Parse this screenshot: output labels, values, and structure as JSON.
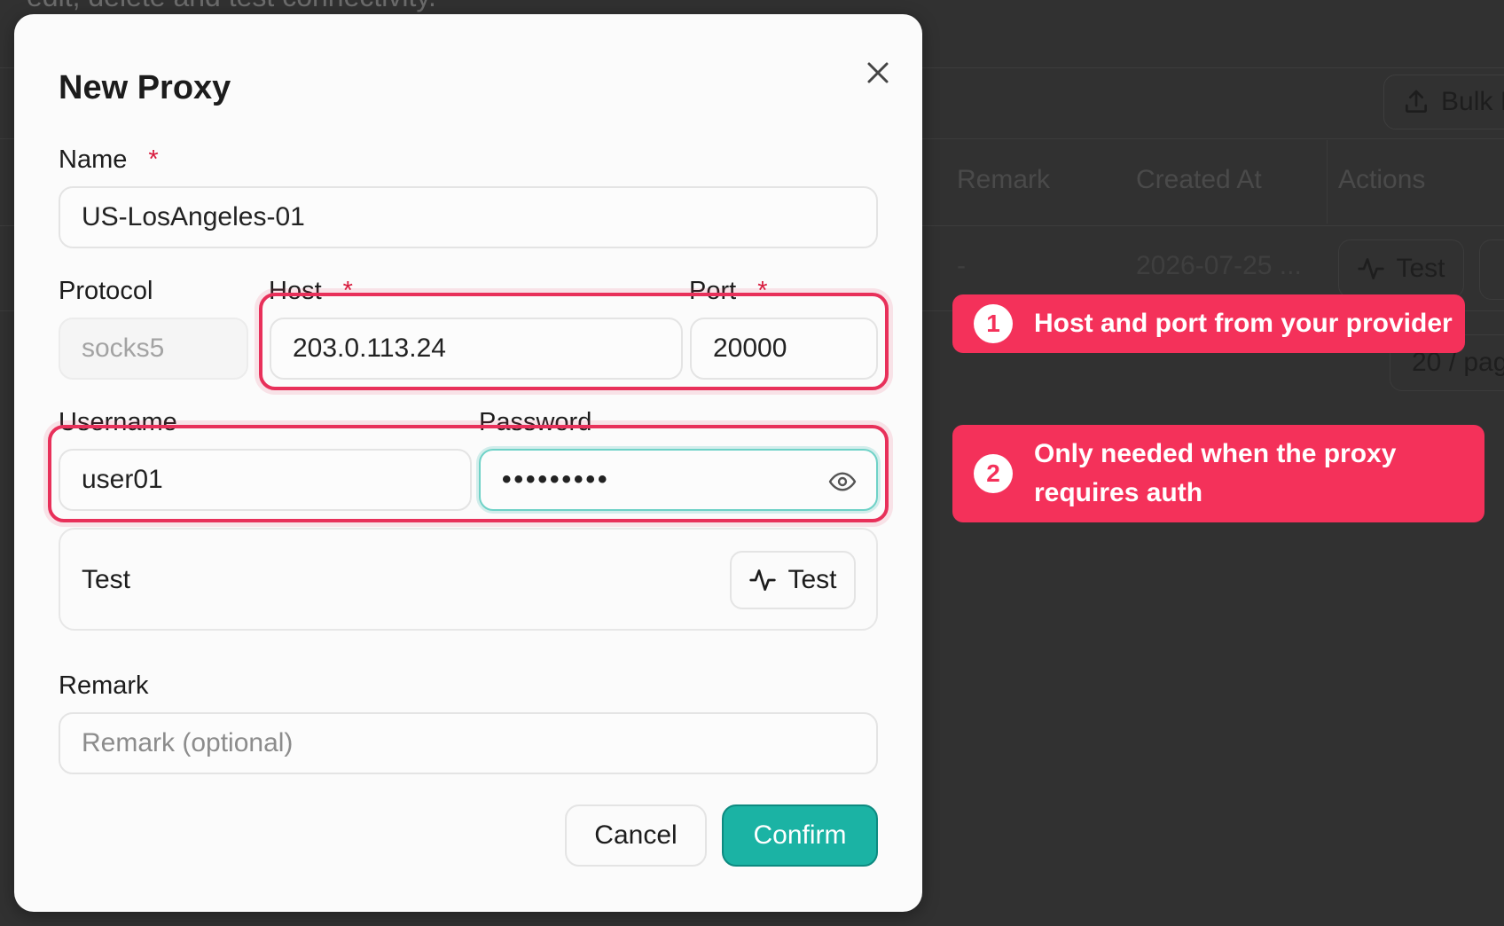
{
  "background": {
    "subtitle": "edit, delete and test connectivity.",
    "bulk_import_label": "Bulk I",
    "table_headers": [
      "Remark",
      "Created At",
      "Actions"
    ],
    "row": {
      "remark": "-",
      "created_at": "2026-07-25 ...",
      "test_label": "Test"
    },
    "pager_label": "20 / pag"
  },
  "modal": {
    "title": "New Proxy",
    "name": {
      "label": "Name",
      "required_mark": "*",
      "value": "US-LosAngeles-01"
    },
    "protocol": {
      "label": "Protocol",
      "value": "socks5"
    },
    "host": {
      "label": "Host",
      "required_mark": "*",
      "value": "203.0.113.24"
    },
    "port": {
      "label": "Port",
      "required_mark": "*",
      "value": "20000"
    },
    "username": {
      "label": "Username",
      "value": "user01"
    },
    "password": {
      "label": "Password",
      "masked_value": "•••••••••"
    },
    "test_section": {
      "label": "Test",
      "button_label": "Test"
    },
    "remark": {
      "label": "Remark",
      "placeholder": "Remark (optional)"
    },
    "cancel_label": "Cancel",
    "confirm_label": "Confirm"
  },
  "callouts": [
    {
      "number": "1",
      "text": "Host and port from your provider"
    },
    {
      "number": "2",
      "text": "Only needed when the proxy requires auth"
    }
  ],
  "colors": {
    "accent": "#1bb3a4",
    "highlight": "#e8305a",
    "callout": "#f4315a",
    "required": "#d81b3d"
  },
  "icons": [
    "close-icon",
    "eye-icon",
    "activity-icon",
    "upload-icon"
  ]
}
